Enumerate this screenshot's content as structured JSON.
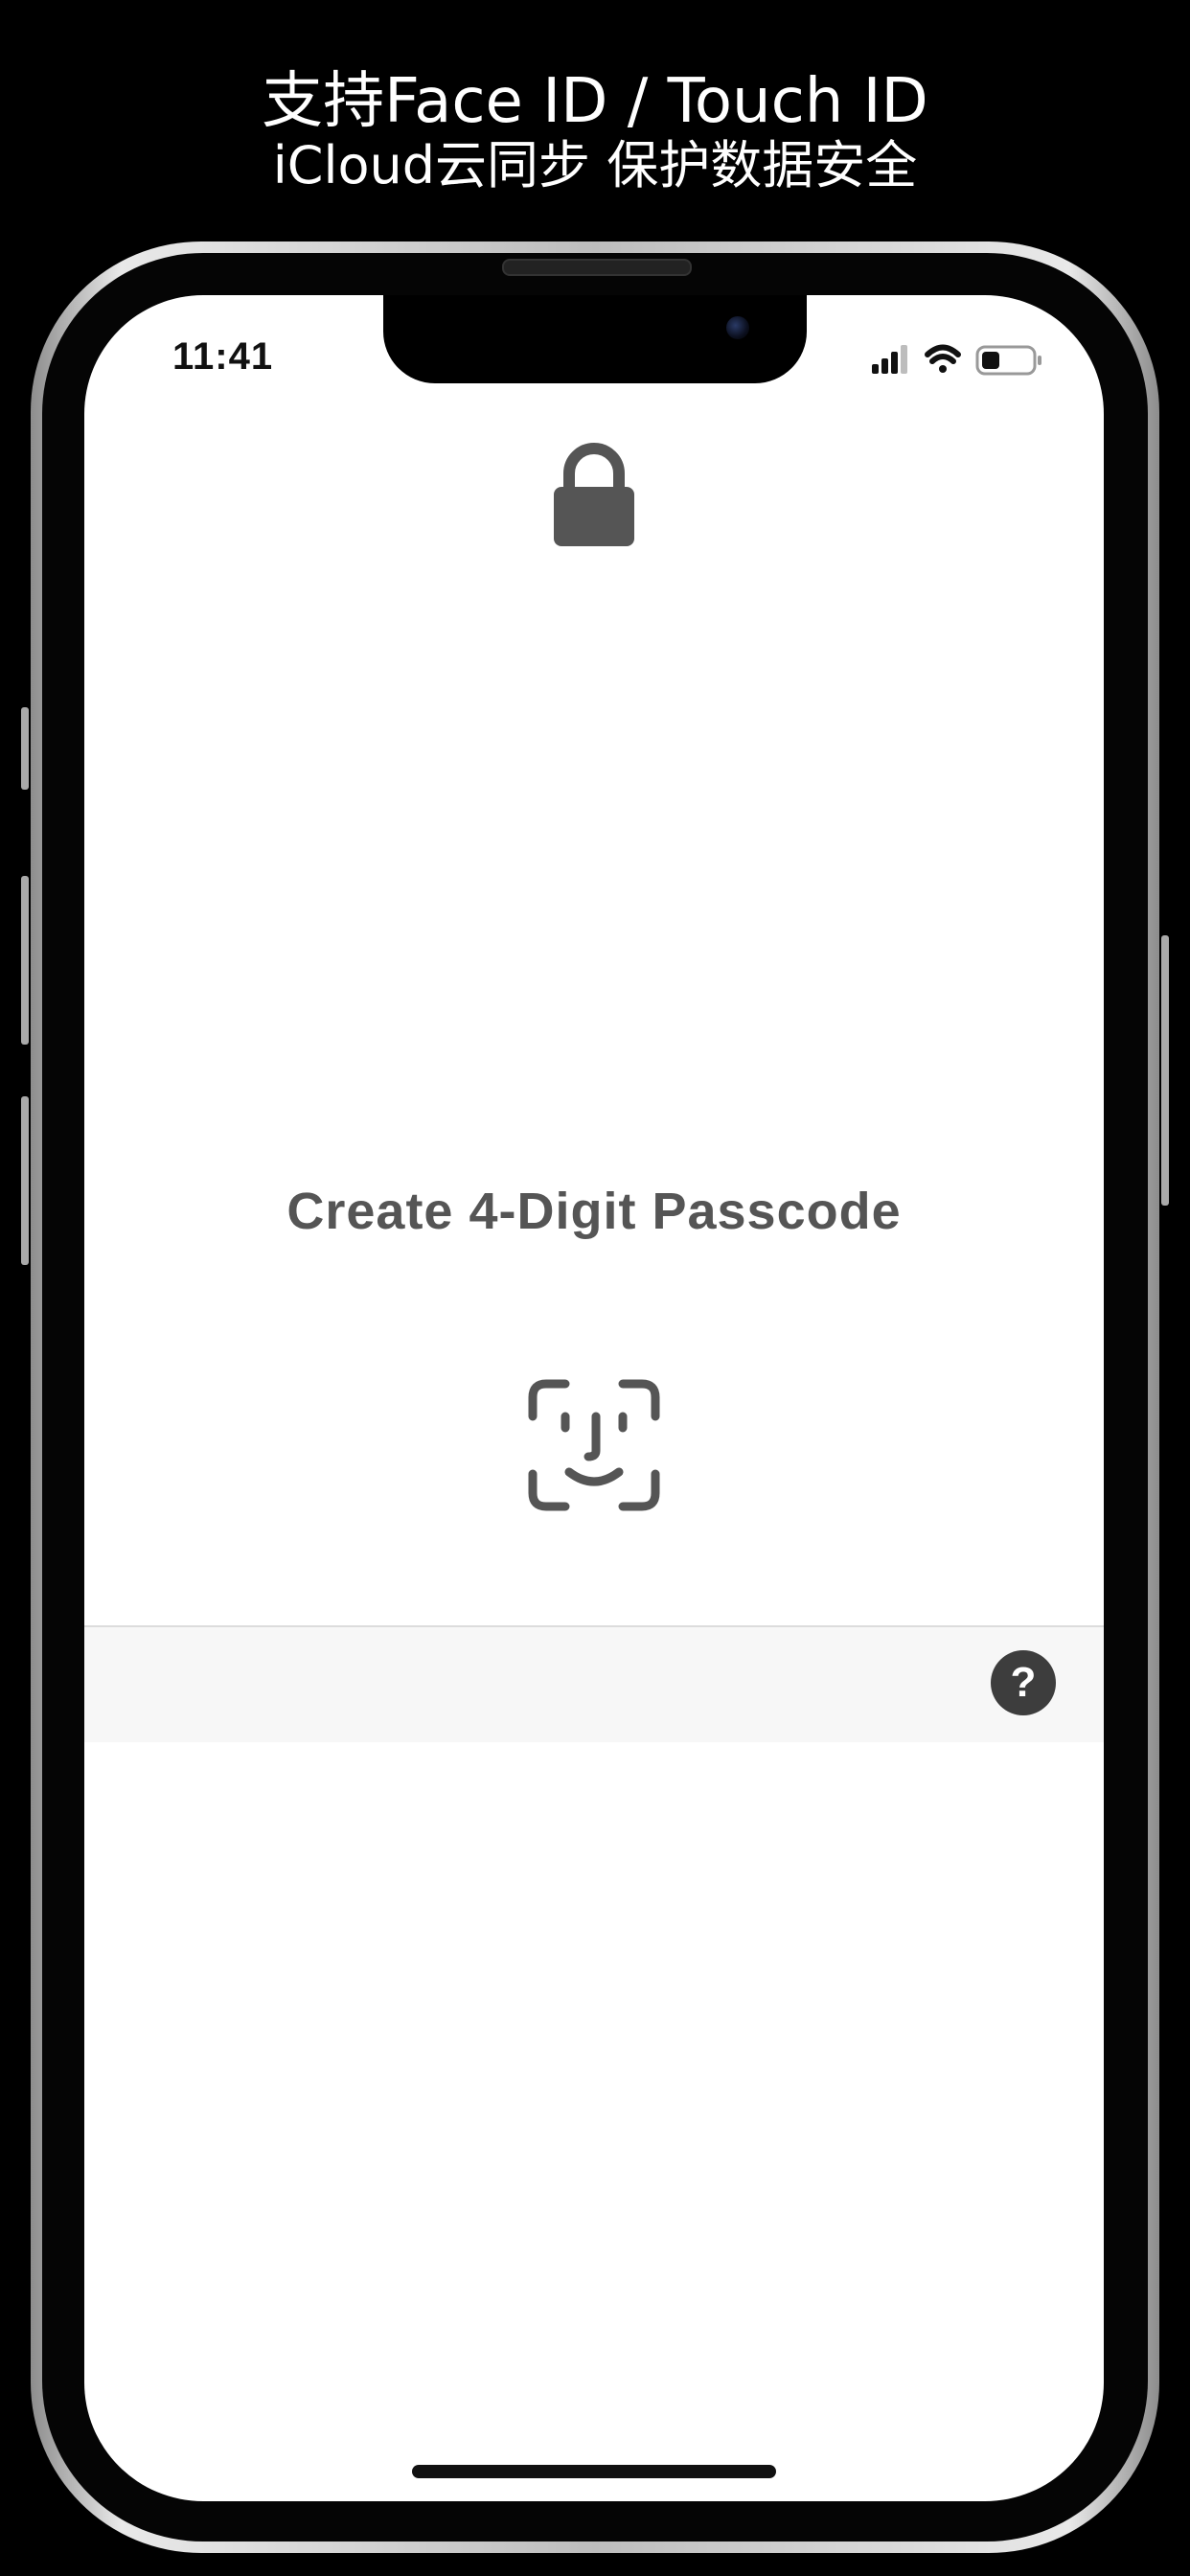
{
  "caption": {
    "line1": "支持Face ID / Touch ID",
    "line2": "iCloud云同步 保护数据安全"
  },
  "status_bar": {
    "time": "11:41",
    "icons": [
      "cellular-signal-icon",
      "wifi-icon",
      "battery-icon"
    ]
  },
  "screen": {
    "lock_icon": "lock-icon",
    "title": "Create 4-Digit Passcode",
    "biometric_icon": "face-id-icon"
  },
  "toolbar": {
    "help_label": "?"
  },
  "colors": {
    "background": "#000000",
    "screen": "#ffffff",
    "icon_gray": "#555555",
    "toolbar": "#f7f7f7",
    "help_button": "#3d3d3d"
  }
}
